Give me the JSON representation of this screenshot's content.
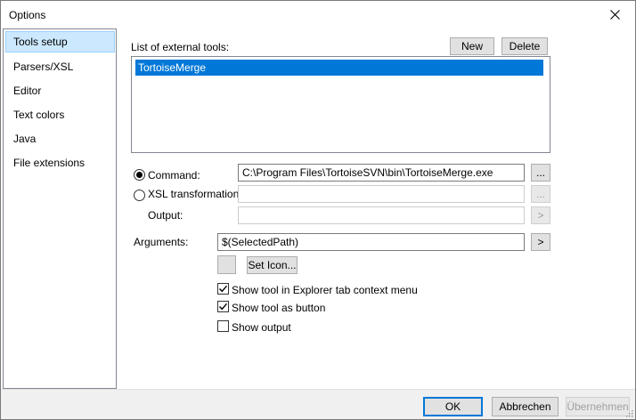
{
  "window": {
    "title": "Options",
    "close_icon": "close-icon"
  },
  "sidebar": {
    "items": [
      {
        "label": "Tools setup",
        "selected": true
      },
      {
        "label": "Parsers/XSL"
      },
      {
        "label": "Editor"
      },
      {
        "label": "Text colors"
      },
      {
        "label": "Java"
      },
      {
        "label": "File extensions"
      }
    ]
  },
  "tools": {
    "list_label": "List of external tools:",
    "new_label": "New",
    "delete_label": "Delete",
    "items": [
      "TortoiseMerge"
    ],
    "selected_index": 0
  },
  "command": {
    "radio_label": "Command:",
    "checked": true,
    "value": "C:\\Program Files\\TortoiseSVN\\bin\\TortoiseMerge.exe",
    "browse_label": "..."
  },
  "xsl": {
    "radio_label": "XSL transformation:",
    "checked": false,
    "value": "",
    "browse_label": "..."
  },
  "output": {
    "label": "Output:",
    "value": "",
    "arrow_label": ">"
  },
  "arguments": {
    "label": "Arguments:",
    "value": "$(SelectedPath)",
    "arrow_label": ">"
  },
  "icon": {
    "set_icon_label": "Set Icon..."
  },
  "options": [
    {
      "label": "Show tool in Explorer tab context menu",
      "checked": true
    },
    {
      "label": "Show tool as button",
      "checked": true
    },
    {
      "label": "Show output",
      "checked": false
    }
  ],
  "footer": {
    "ok_label": "OK",
    "cancel_label": "Abbrechen",
    "apply_label": "Übernehmen"
  },
  "colors": {
    "selection": "#0078d7",
    "sidebar_selection": "#cce8ff",
    "footer_bg": "#f0f0f0"
  }
}
